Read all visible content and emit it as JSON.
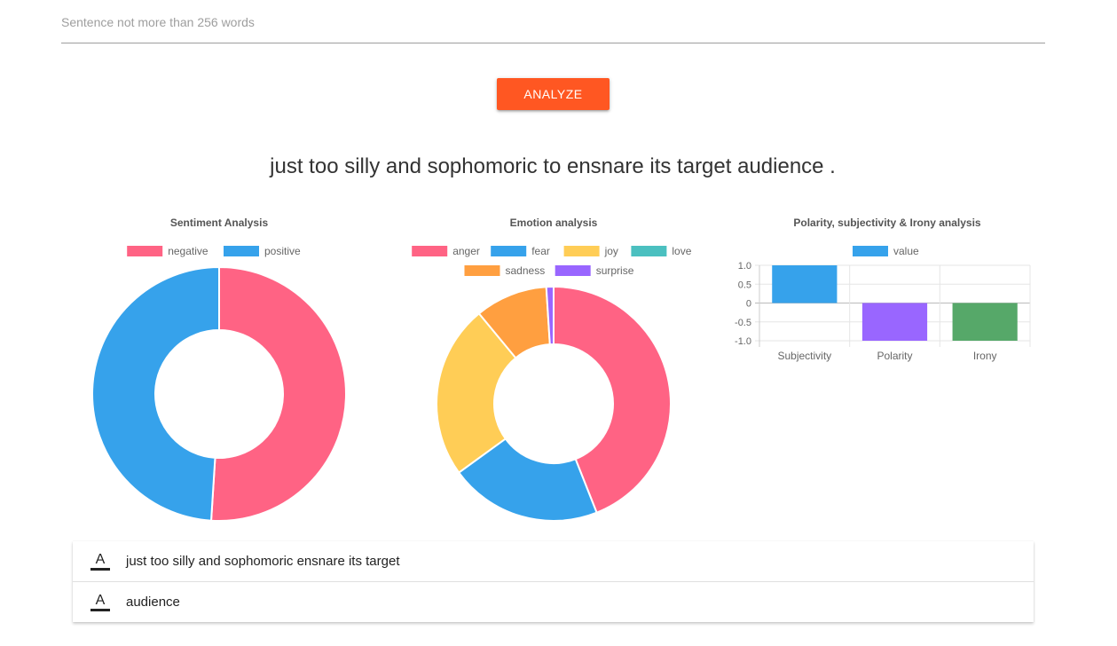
{
  "input": {
    "placeholder": "Sentence not more than 256 words",
    "value": ""
  },
  "analyze_button": {
    "label": "ANALYZE",
    "color": "#ff5722"
  },
  "analyzed_sentence": "just too silly and sophomoric to ensnare its target audience .",
  "chart_data": [
    {
      "type": "pie",
      "variant": "doughnut",
      "title": "Sentiment Analysis",
      "legend_position": "top",
      "labels": [
        "negative",
        "positive"
      ],
      "values": [
        0.51,
        0.49
      ],
      "colors": [
        "#ff6384",
        "#36a2eb"
      ]
    },
    {
      "type": "pie",
      "variant": "doughnut",
      "title": "Emotion analysis",
      "legend_position": "top",
      "labels": [
        "anger",
        "fear",
        "joy",
        "love",
        "sadness",
        "surprise"
      ],
      "values": [
        0.44,
        0.21,
        0.24,
        0.0,
        0.1,
        0.01
      ],
      "colors": [
        "#ff6384",
        "#36a2eb",
        "#ffcd56",
        "#4bc0c0",
        "#ff9f40",
        "#9966ff"
      ]
    },
    {
      "type": "bar",
      "title": "Polarity, subjectivity & Irony analysis",
      "legend_position": "top",
      "categories": [
        "Subjectivity",
        "Polarity",
        "Irony"
      ],
      "series": [
        {
          "name": "value",
          "values": [
            1.0,
            -1.0,
            -1.0
          ]
        }
      ],
      "bar_colors": [
        "#36a2eb",
        "#9966ff",
        "#56a869"
      ],
      "ylim": [
        -1.0,
        1.0
      ],
      "yticks": [
        "1.0",
        "0.5",
        "0",
        "-0.5",
        "-1.0"
      ],
      "grid": true
    }
  ],
  "tokens": [
    {
      "icon": "text-format-icon",
      "glyph": "A",
      "text": "just too silly and sophomoric ensnare its target"
    },
    {
      "icon": "text-format-icon",
      "glyph": "A",
      "text": "audience"
    }
  ]
}
